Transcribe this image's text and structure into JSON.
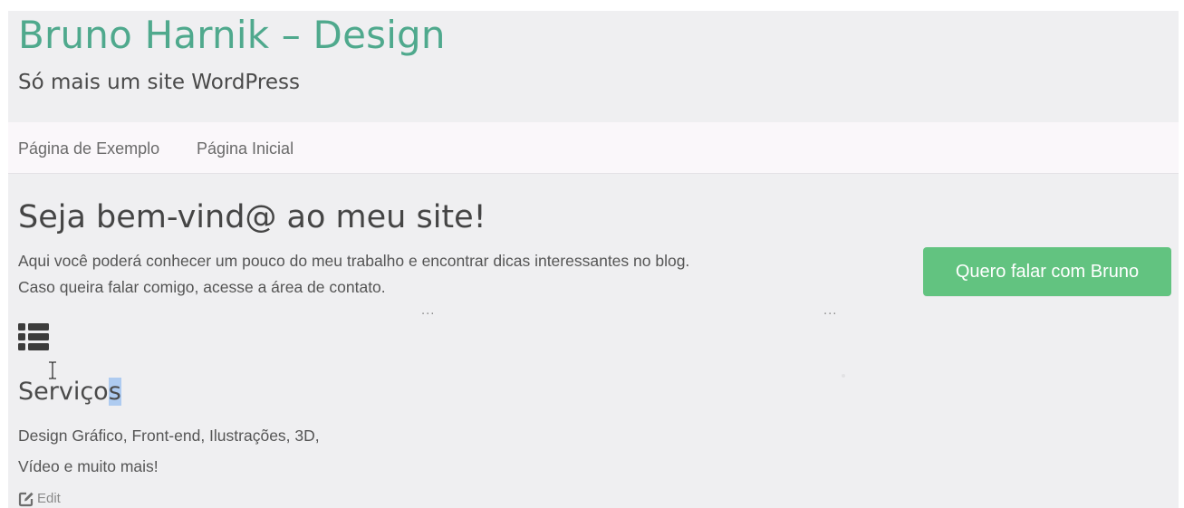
{
  "header": {
    "site_title": "Bruno Harnik – Design",
    "tagline": "Só mais um site WordPress"
  },
  "nav": {
    "items": [
      {
        "label": "Página de Exemplo"
      },
      {
        "label": "Página Inicial"
      }
    ]
  },
  "hero": {
    "title": "Seja bem-vind@ ao meu site!",
    "lines": [
      "Aqui você poderá conhecer um pouco do meu trabalho e encontrar dicas interessantes no blog.",
      "Caso queira falar comigo, acesse a área de contato."
    ],
    "cta_label": "Quero falar com Bruno",
    "ellipsis_left": "...",
    "ellipsis_right": "..."
  },
  "services": {
    "icon": "list-icon",
    "title_plain": "Serviço",
    "title_selected": "s",
    "lines": [
      "Design Gráfico, Front-end, Ilustrações, 3D,",
      "Vídeo e muito mais!"
    ],
    "edit_icon": "edit-icon",
    "edit_label": "Edit"
  },
  "colors": {
    "title_accent": "#4fa98d",
    "cta_background": "#62c380",
    "page_background": "#efeff1",
    "nav_background": "#faf7fa",
    "selection": "#aecbf0"
  }
}
